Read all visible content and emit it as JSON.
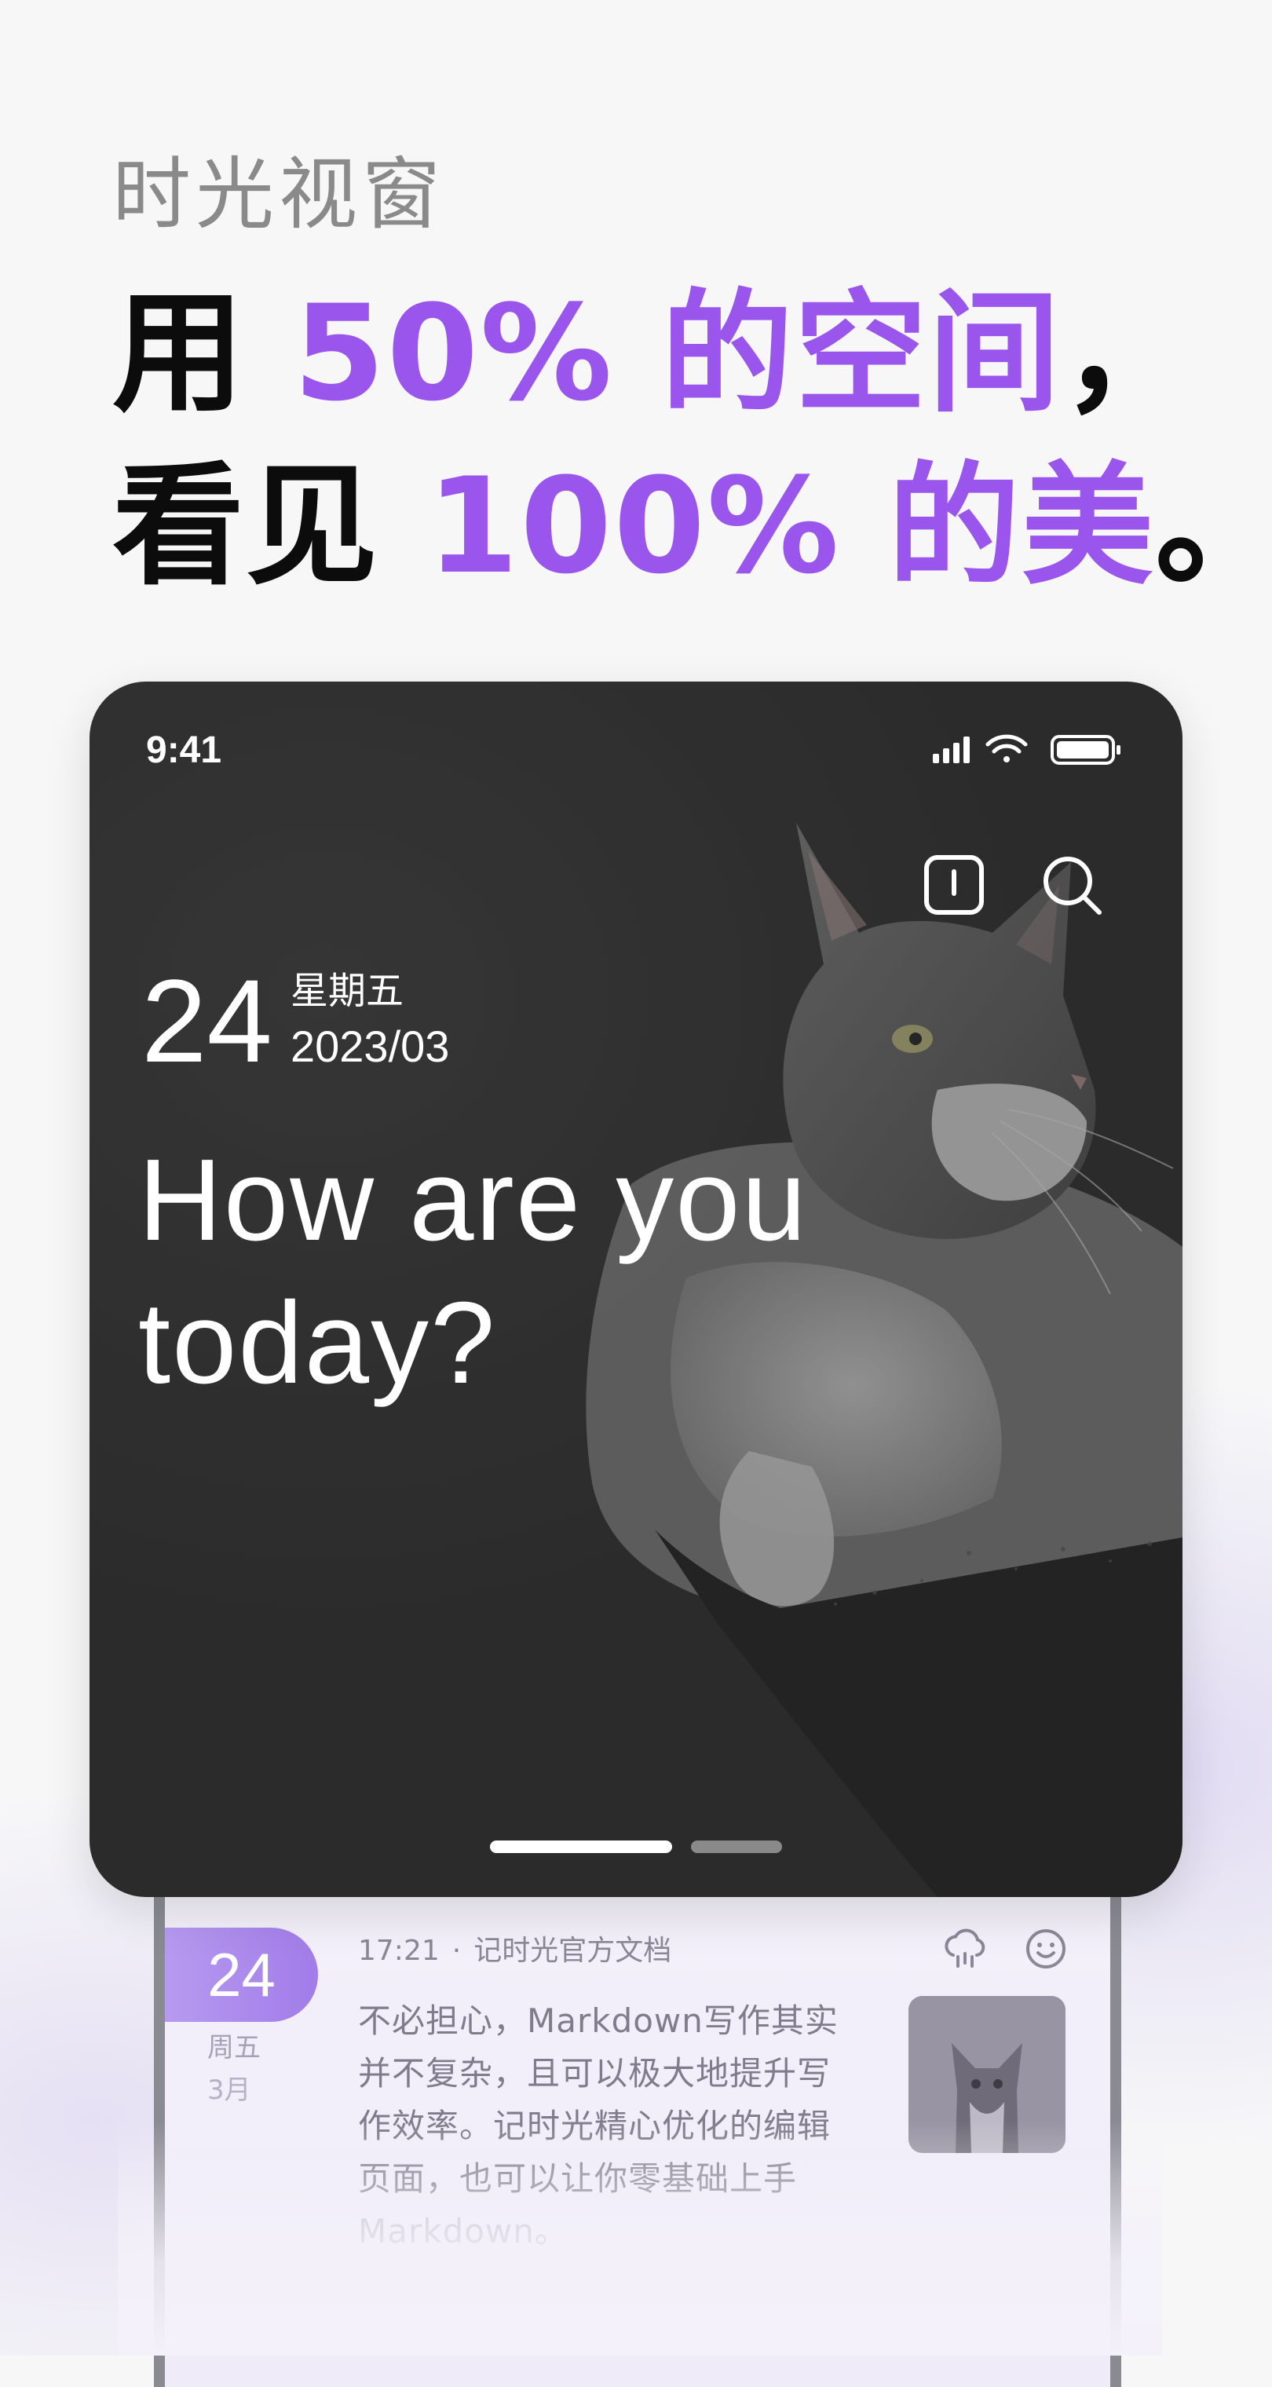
{
  "promo": {
    "subtitle": "时光视窗",
    "line1": {
      "pre": "用 ",
      "accent": "50% 的空间",
      "post": "，"
    },
    "line2": {
      "pre": "看见 ",
      "accent": "100% 的美",
      "post": "。"
    },
    "accent_color": "#9a55ec"
  },
  "status_bar": {
    "time": "9:41",
    "icons": [
      "signal-icon",
      "wifi-icon",
      "battery-icon"
    ]
  },
  "card": {
    "toolbar_icons": [
      "notebook-icon",
      "search-icon"
    ],
    "day": "24",
    "weekday": "星期五",
    "year_month": "2023/03",
    "greeting_line1": "How are you",
    "greeting_line2": "today?",
    "background_image": "cat-photo",
    "pager": {
      "total": 2,
      "active": 1
    }
  },
  "entry": {
    "day": "24",
    "weekday": "周五",
    "month": "3月",
    "time": "17:21",
    "separator": "·",
    "source": "记时光官方文档",
    "weather_icon": "cloud-rain-icon",
    "mood_icon": "smile-icon",
    "thumbnail": "cat-thumbnail",
    "text_lines": [
      "不必担心，Markdown写作其实",
      "并不复杂，且可以极大地提升写",
      "作效率。记时光精心优化的编辑",
      "页面，也可以让你零基础上手",
      "Markdown。"
    ]
  }
}
